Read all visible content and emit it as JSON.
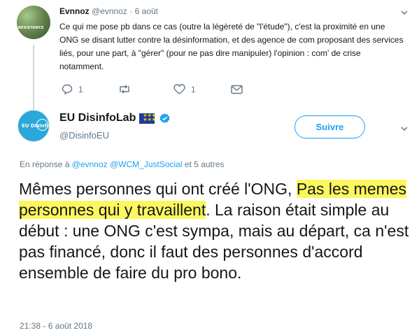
{
  "reply_tweet": {
    "avatar_text": "RESISTANCE",
    "name": "Evnnoz",
    "handle": "@evnnoz",
    "separator": "·",
    "date": "6 août",
    "text": "Ce qui me pose pb dans ce cas (outre la légèreté de \"l'étude\"), c'est la proximité en une ONG se disant lutter contre la désinformation, et des agence de com proposant des services liés, pour une part, à \"gérer\" (pour ne pas dire manipuler) l'opinion : com' de crise notamment.",
    "actions": {
      "reply_count": "1",
      "retweet_count": "",
      "like_count": "1"
    },
    "icons": [
      "reply-icon",
      "retweet-icon",
      "like-icon",
      "dm-icon",
      "chevron-down-icon"
    ]
  },
  "main_tweet": {
    "avatar_text": "EU DisinfoLab",
    "name": "EU DisinfoLab",
    "handle": "@DisinfoEU",
    "follow_label": "Suivre",
    "reply_prefix": "En réponse à",
    "reply_mention_1": "@evnnoz",
    "reply_mention_2": "@WCM_JustSocial",
    "reply_suffix": "et 5 autres",
    "text_before": "Mêmes personnes qui ont créé l'ONG, ",
    "text_highlight": "Pas les memes personnes qui y travaillent",
    "text_after": ". La raison était simple au début : une ONG c'est sympa, mais au départ, ca n'est pas financé, donc il faut des personnes d'accord ensemble de faire du pro bono.",
    "timestamp": "21:38 - 6 août 2018",
    "colors": {
      "accent": "#1da1f2",
      "highlight": "#fcf75e",
      "muted": "#657786",
      "eu_flag": "#1f3c99",
      "avatar": "#2aa8d8"
    }
  }
}
